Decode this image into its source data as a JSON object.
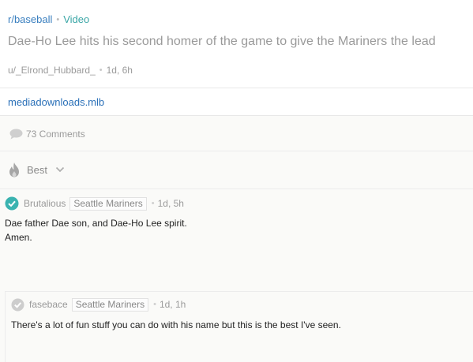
{
  "post": {
    "subreddit": "r/baseball",
    "flair": "Video",
    "title": "Dae-Ho Lee hits his second homer of the game to give the Mariners the lead",
    "author": "u/_Elrond_Hubbard_",
    "age": "1d, 6h",
    "link_domain": "mediadownloads.mlb"
  },
  "comments_bar": {
    "label": "73 Comments",
    "icon": "comment-bubble-icon"
  },
  "sort": {
    "label": "Best",
    "icon": "flame-icon"
  },
  "comments": [
    {
      "author": "Brutalious",
      "flair": "Seattle Mariners",
      "age": "1d, 5h",
      "body_line1": "Dae father Dae son, and Dae-Ho Lee spirit.",
      "body_line2": "Amen.",
      "icon": "upvoted-check-icon"
    },
    {
      "author": "fasebace",
      "flair": "Seattle Mariners",
      "age": "1d, 1h",
      "body_line1": "There's a lot of fun stuff you can do with his name but this is the best I've seen.",
      "icon": "check-icon"
    }
  ],
  "colors": {
    "subreddit": "#3a7fbf",
    "flair_video": "#3aa6a6",
    "link": "#2a70b8",
    "upvoted": "#3ab3b0"
  }
}
